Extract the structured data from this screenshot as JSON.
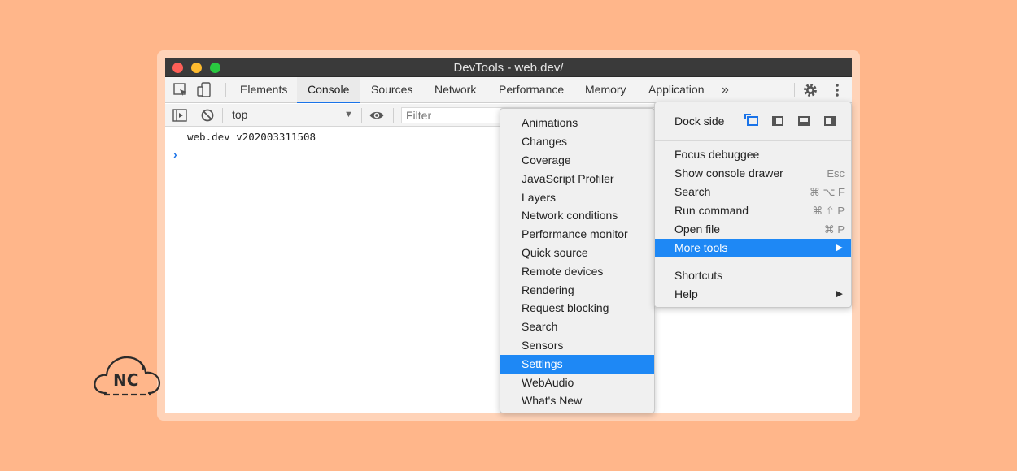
{
  "window": {
    "title": "DevTools - web.dev/"
  },
  "tabs": [
    "Elements",
    "Console",
    "Sources",
    "Network",
    "Performance",
    "Memory",
    "Application"
  ],
  "tabs_overflow": "»",
  "console": {
    "context": "top",
    "filter_placeholder": "Filter",
    "log_line": "web.dev v202003311508",
    "prompt": "›"
  },
  "main_menu": {
    "dock_side_label": "Dock side",
    "items": [
      {
        "label": "Focus debuggee",
        "shortcut": ""
      },
      {
        "label": "Show console drawer",
        "shortcut": "Esc"
      },
      {
        "label": "Search",
        "shortcut": "⌘ ⌥ F"
      },
      {
        "label": "Run command",
        "shortcut": "⌘ ⇧ P"
      },
      {
        "label": "Open file",
        "shortcut": "⌘ P"
      },
      {
        "label": "More tools",
        "arrow": "▶"
      },
      {
        "label": "Shortcuts"
      },
      {
        "label": "Help",
        "arrow": "▶"
      }
    ]
  },
  "more_tools_submenu": [
    "Animations",
    "Changes",
    "Coverage",
    "JavaScript Profiler",
    "Layers",
    "Network conditions",
    "Performance monitor",
    "Quick source",
    "Remote devices",
    "Rendering",
    "Request blocking",
    "Search",
    "Sensors",
    "Settings",
    "WebAudio",
    "What's New"
  ],
  "highlighted": {
    "main_menu": "More tools",
    "submenu": "Settings"
  },
  "logo": {
    "text": "NC"
  },
  "colors": {
    "background": "#FFB68A",
    "accent": "#1E88F5",
    "tab_underline": "#1A73E8"
  }
}
